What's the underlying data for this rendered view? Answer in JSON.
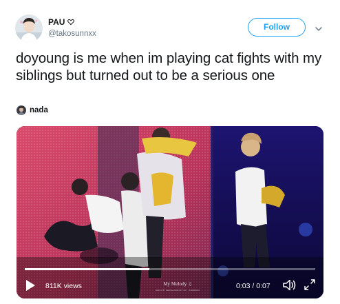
{
  "header": {
    "display_name": "PAU",
    "badge_icon": "heart-outline-icon",
    "handle": "@takosunnxx",
    "follow_label": "Follow",
    "menu_icon": "chevron-down-icon"
  },
  "tweet": {
    "text": "doyoung is me when im playing cat fights with my siblings but turned out to be a serious one"
  },
  "tagged": {
    "name": "nada"
  },
  "video": {
    "views": "811K views",
    "time": "0:03 / 0:07",
    "progress": 0.43,
    "watermark": "My Melody ♫",
    "watermark_sub": "NEO CITY SEOUL 2019 NCT 127 · JUNGWOO",
    "icons": {
      "play": "play-icon",
      "volume": "volume-icon",
      "fullscreen": "fullscreen-icon"
    }
  },
  "colors": {
    "accent": "#1da1f2",
    "text": "#14171a",
    "secondary": "#657786"
  }
}
